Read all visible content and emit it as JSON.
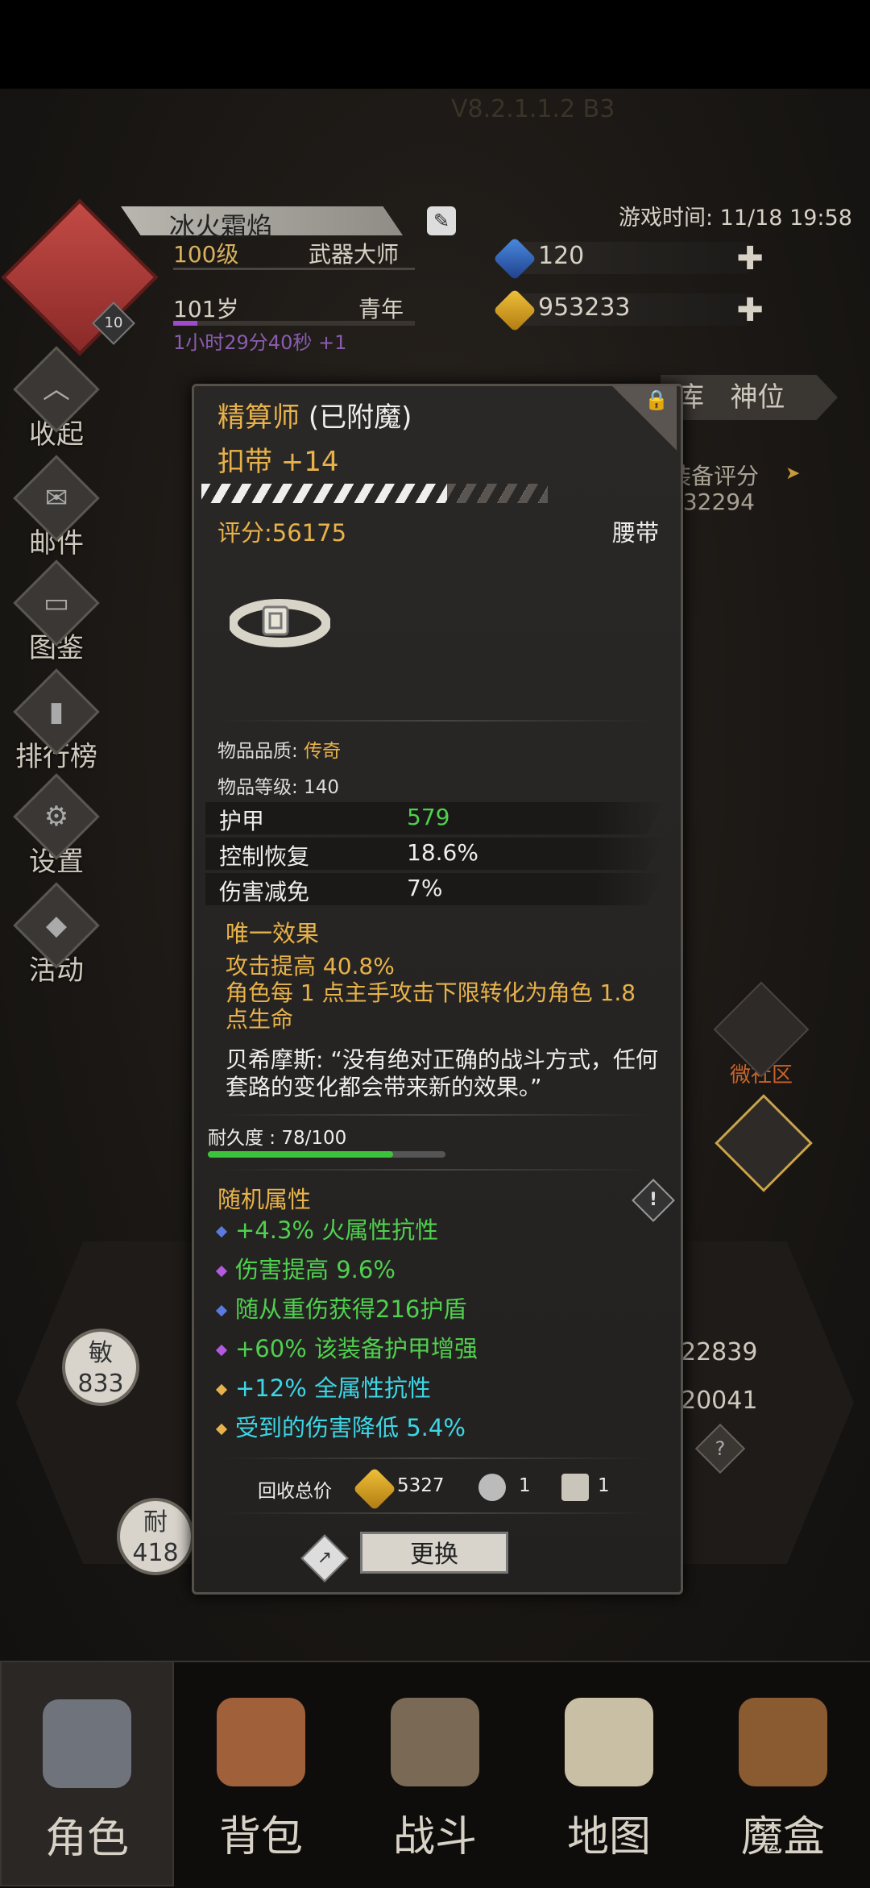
{
  "header": {
    "faint_title": "V8.2.1.1.2 B3",
    "player_name": "冰火霜焰",
    "avatar_level": "10",
    "level": "100级",
    "title": "武器大师",
    "age": "101岁",
    "stage": "青年",
    "timer": "1小时29分40秒 +1",
    "game_time": "游戏时间: 11/18 19:58",
    "gems": "120",
    "gold": "953233",
    "plus": "✚",
    "edit_icon": "✎"
  },
  "side_menu": [
    {
      "label": "收起",
      "icon": "collapse-icon",
      "glyph": "︿"
    },
    {
      "label": "邮件",
      "icon": "mail-icon",
      "glyph": "✉"
    },
    {
      "label": "图鉴",
      "icon": "book-icon",
      "glyph": "▭"
    },
    {
      "label": "排行榜",
      "icon": "ranking-icon",
      "glyph": "▮"
    },
    {
      "label": "设置",
      "icon": "gear-icon",
      "glyph": "⚙"
    },
    {
      "label": "活动",
      "icon": "event-icon",
      "glyph": "◆"
    }
  ],
  "background": {
    "tab_storage": "库",
    "tab_temple": "神位",
    "equip_score_label": "装备评分",
    "equip_score_value": "732294",
    "community": "微社区",
    "right_stat_1": "22839",
    "right_stat_2": "20041",
    "stat_agi_label": "敏",
    "stat_agi_value": "833",
    "stat_end_label": "耐",
    "stat_end_value": "418",
    "help": "?"
  },
  "item": {
    "name": "精算师",
    "enchant": "(已附魔)",
    "type_line": "扣带 +14",
    "score": "评分:56175",
    "slot": "腰带",
    "quality_label": "物品品质: ",
    "quality_value": "传奇",
    "item_level": "物品等级: 140",
    "stats": [
      {
        "name": "护甲",
        "value": "579",
        "color": "#4fd04f"
      },
      {
        "name": "控制恢复",
        "value": "18.6%"
      },
      {
        "name": "伤害减免",
        "value": "7%"
      }
    ],
    "unique_header": "唯一效果",
    "unique_text": "攻击提高 40.8%\n角色每 1 点主手攻击下限转化为角色 1.8 点生命",
    "lore": "贝希摩斯: “没有绝对正确的战斗方式，任何套路的变化都会带来新的效果。”",
    "durability": "耐久度 : 78/100",
    "durability_fraction": 0.78,
    "random_header": "随机属性",
    "random_attrs": [
      {
        "text": "+4.3% 火属性抗性",
        "color": "#4fd04f",
        "bullet": "#5a7adf"
      },
      {
        "text": "伤害提高 9.6%",
        "color": "#4fd04f",
        "bullet": "#b45ae0"
      },
      {
        "text": "随从重伤获得216护盾",
        "color": "#4fd04f",
        "bullet": "#5a7adf"
      },
      {
        "text": "+60% 该装备护甲增强",
        "color": "#4fd04f",
        "bullet": "#b45ae0"
      },
      {
        "text": "+12% 全属性抗性",
        "color": "#3cd6e6",
        "bullet": "#e8b24a"
      },
      {
        "text": "受到的伤害降低 5.4%",
        "color": "#3cd6e6",
        "bullet": "#e8b24a"
      }
    ],
    "recycle_label": "回收总价",
    "recycle_gold": "5327",
    "recycle_mat1": "1",
    "recycle_mat2": "1",
    "swap_label": "更换",
    "share_glyph": "↗",
    "lock_glyph": "🔒"
  },
  "nav": [
    {
      "label": "角色",
      "icon": "helmet-icon",
      "color": "#7a7f87"
    },
    {
      "label": "背包",
      "icon": "backpack-icon",
      "color": "#a0603a"
    },
    {
      "label": "战斗",
      "icon": "sword-shield-icon",
      "color": "#7a6a55"
    },
    {
      "label": "地图",
      "icon": "map-scroll-icon",
      "color": "#c9bfa5"
    },
    {
      "label": "魔盒",
      "icon": "magic-box-icon",
      "color": "#8a5a30"
    }
  ],
  "colors": {
    "accent_gold": "#e8b24a",
    "green": "#4fd04f",
    "cyan": "#3cd6e6"
  }
}
